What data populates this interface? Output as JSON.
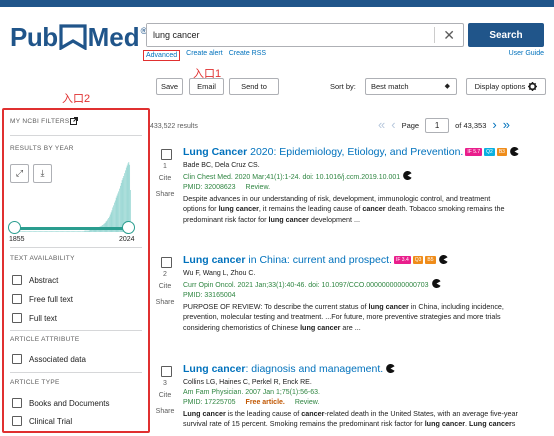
{
  "header": {
    "logo_pub": "Pub",
    "logo_med": "Med",
    "logo_reg": "®",
    "search_value": "lung cancer",
    "search_button": "Search",
    "advanced": "Advanced",
    "create_alert": "Create alert",
    "create_rss": "Create RSS",
    "user_guide": "User Guide",
    "brand_color": "#20558a"
  },
  "annotations": {
    "label1": "入口1",
    "label2": "入口2",
    "color": "#e03030"
  },
  "toolbar": {
    "save": "Save",
    "email": "Email",
    "send_to": "Send to",
    "sort_by_label": "Sort by:",
    "sort_value": "Best match",
    "display_options": "Display options"
  },
  "sidebar": {
    "my_ncbi_filters": "MY NCBI FILTERS",
    "results_by_year": "RESULTS BY YEAR",
    "year_start": "1855",
    "year_end": "2024",
    "text_availability": "TEXT AVAILABILITY",
    "abstract": "Abstract",
    "free_full_text": "Free full text",
    "full_text": "Full text",
    "article_attribute": "ARTICLE ATTRIBUTE",
    "associated_data": "Associated data",
    "article_type": "ARTICLE TYPE",
    "books_documents": "Books and Documents",
    "clinical_trial": "Clinical Trial"
  },
  "results": {
    "count": "433,522 results",
    "page_label": "Page",
    "page_value": "1",
    "of_pages": "of 43,353"
  },
  "articles": [
    {
      "num": "1",
      "title_bold": "Lung Cancer",
      "title_rest": " 2020: Epidemiology, Etiology, and Prevention.",
      "badges": [
        "IF 5.7",
        "Q2",
        "B3"
      ],
      "authors": "Bade BC, Dela Cruz CS.",
      "journal": "Clin Chest Med. 2020 Mar;41(1):1-24. doi: 10.1016/j.ccm.2019.10.001",
      "pmid": "PMID: 32008623",
      "free": "",
      "type": "Review.",
      "snippet_1": "Despite advances in our understanding of risk, development, immunologic control, and treatment",
      "snippet_2a": "options for ",
      "snippet_2b": "lung cancer",
      "snippet_2c": ", it remains the leading cause of ",
      "snippet_2d": "cancer",
      "snippet_2e": " death. Tobacco smoking remains the",
      "snippet_3a": "predominant risk factor for ",
      "snippet_3b": "lung cancer",
      "snippet_3c": " development ..."
    },
    {
      "num": "2",
      "title_bold": "Lung cancer",
      "title_rest": " in China: current and prospect.",
      "badges": [
        "IF 3.4",
        "Q3",
        "B5"
      ],
      "authors": "Wu F, Wang L, Zhou C.",
      "journal": "Curr Opin Oncol. 2021 Jan;33(1):40-46. doi: 10.1097/CCO.0000000000000703",
      "pmid": "PMID: 33165004",
      "free": "",
      "type": "",
      "snippet_1a": "PURPOSE OF REVIEW: To describe the current status of ",
      "snippet_1b": "lung cancer",
      "snippet_1c": " in China, including incidence,",
      "snippet_2": "prevention, molecular testing and treatment. ...For future, more preventive strategies and more trials",
      "snippet_3a": "considering chemoristics of Chinese ",
      "snippet_3b": "lung cancer",
      "snippet_3c": " are ..."
    },
    {
      "num": "3",
      "title_bold": "Lung cancer",
      "title_rest": ": diagnosis and management.",
      "badges": [],
      "authors": "Collins LG, Haines C, Perkel R, Enck RE.",
      "journal": "Am Fam Physician. 2007 Jan 1;75(1):56-63.",
      "pmid": "PMID: 17225705",
      "free": "Free article.",
      "type": "Review.",
      "snippet_1a": "Lung cancer",
      "snippet_1b": " is the leading cause of ",
      "snippet_1c": "cancer",
      "snippet_1d": "-related death in the United States, with an average five-year",
      "snippet_2a": "survival rate of 15 percent. Smoking remains the predominant risk factor for ",
      "snippet_2b": "lung cancer",
      "snippet_2c": ". ",
      "snippet_2d": "Lung cancer",
      "snippet_2e": "s"
    }
  ],
  "labels": {
    "cite": "Cite",
    "share": "Share"
  },
  "histogram": [
    1,
    1,
    1,
    1,
    1,
    1,
    1,
    1,
    1,
    1,
    1,
    1,
    1,
    1,
    1,
    1,
    1,
    1,
    1,
    1,
    1,
    1,
    1,
    1,
    1,
    1,
    1,
    1,
    1,
    1,
    1,
    1,
    1,
    1,
    1,
    1,
    1,
    1,
    1,
    1,
    1,
    1,
    1,
    1,
    1,
    1,
    1,
    1,
    1,
    1,
    1,
    1,
    1,
    1,
    1,
    1,
    1,
    1,
    1,
    1,
    1,
    1,
    1,
    1,
    1,
    1,
    1,
    1,
    1,
    1,
    1,
    1,
    1,
    1,
    1,
    1,
    1,
    1,
    1,
    1,
    1,
    1,
    1,
    1,
    1,
    1,
    1,
    2,
    2,
    2,
    2,
    2,
    2,
    3,
    3,
    3,
    3,
    4,
    4,
    4,
    5,
    5,
    6,
    6,
    7,
    8,
    8,
    9,
    10,
    11,
    12,
    13,
    15,
    16,
    18,
    20,
    22,
    25,
    28,
    31,
    35,
    38,
    42,
    45,
    49,
    52,
    55,
    58,
    62,
    66,
    70,
    74,
    77,
    80,
    84,
    88,
    92,
    95,
    98,
    100,
    96,
    60
  ]
}
